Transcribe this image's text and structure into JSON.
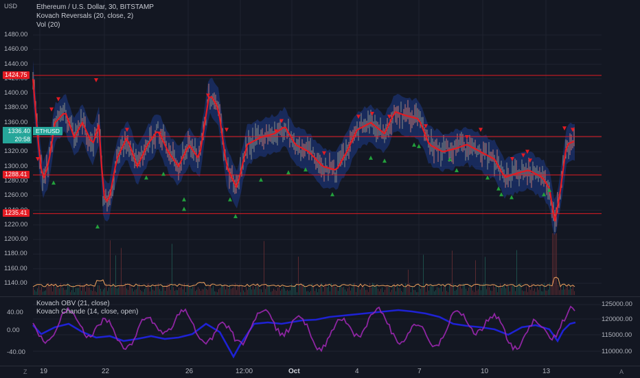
{
  "chart_header": {
    "currency": "USD",
    "symbol_line": "Ethereum / U.S. Dollar, 30, BITSTAMP",
    "indicator_1": "Kovach Reversals (20, close, 2)",
    "indicator_2": "Vol (20)",
    "indicator_3": "Kovach OBV (21, close)",
    "indicator_4": "Kovach Chande (14, close, open)"
  },
  "price_axis": {
    "ticks": [
      "1480.00",
      "1460.00",
      "1440.00",
      "1420.00",
      "1400.00",
      "1380.00",
      "1360.00",
      "1340.00",
      "1320.00",
      "1300.00",
      "1280.00",
      "1260.00",
      "1240.00",
      "1220.00",
      "1200.00",
      "1180.00",
      "1160.00",
      "1140.00"
    ],
    "current_price": "1336.40",
    "countdown": "20:58",
    "symbol_badge": "ETHUSD"
  },
  "levels": [
    {
      "label": "1424.75",
      "value": 1424.75
    },
    {
      "label": "1341.04",
      "value": 1341.04
    },
    {
      "label": "1288.41",
      "value": 1288.41
    },
    {
      "label": "1235.41",
      "value": 1235.41
    }
  ],
  "indicator_axis_left": [
    "40.00",
    "0.00",
    "-40.00"
  ],
  "indicator_axis_right": [
    "125000.00",
    "120000.00",
    "115000.00",
    "110000.00"
  ],
  "time_axis": [
    {
      "label": "19",
      "bold": false
    },
    {
      "label": "22",
      "bold": false
    },
    {
      "label": "26",
      "bold": false
    },
    {
      "label": "12:00",
      "bold": false
    },
    {
      "label": "Oct",
      "bold": true
    },
    {
      "label": "4",
      "bold": false
    },
    {
      "label": "7",
      "bold": false
    },
    {
      "label": "10",
      "bold": false
    },
    {
      "label": "13",
      "bold": false
    }
  ],
  "corner_left": "Z",
  "corner_right": "A",
  "colors": {
    "background": "#131722",
    "level_line": "#e31b23",
    "up_candle": "#26a69a",
    "down_candle": "#ef5350",
    "band": "#1e3a8a",
    "ma_line": "#e31b23",
    "volume_ma": "#f0a35e",
    "obv_line": "#1e22d4",
    "chande_line": "#9c27b0"
  },
  "chart_data": {
    "type": "line",
    "title": "Ethereum / U.S. Dollar, 30, BITSTAMP",
    "x": [
      "19",
      "22",
      "26",
      "12:00",
      "Oct",
      "4",
      "7",
      "10",
      "13"
    ],
    "ylim": [
      1130,
      1490
    ],
    "series": [
      {
        "name": "Kovach Reversals (20, close, 2)",
        "values": [
          1330,
          1270,
          1300,
          1365,
          1300,
          1325,
          1300,
          1340,
          1370,
          1330,
          1310,
          1310,
          1275,
          1300,
          1330
        ]
      }
    ],
    "horizontal_levels": [
      1424.75,
      1341.04,
      1288.41,
      1235.41
    ],
    "current_price": 1336.4
  }
}
